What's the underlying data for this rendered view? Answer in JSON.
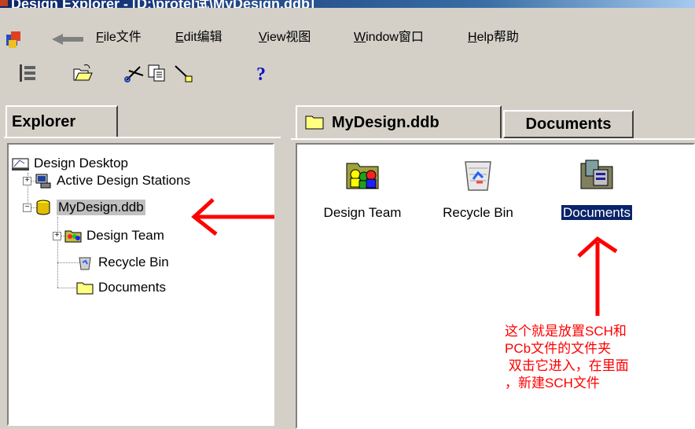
{
  "window": {
    "title": "Design Explorer - [D:\\protel试\\MyDesign.ddb]"
  },
  "menu": {
    "items": [
      {
        "accel": "F",
        "rest": "ile文件"
      },
      {
        "accel": "E",
        "rest": "dit编辑"
      },
      {
        "accel": "V",
        "rest": "iew视图"
      },
      {
        "accel": "W",
        "rest": "indow窗口"
      },
      {
        "accel": "H",
        "rest": "elp帮助"
      }
    ]
  },
  "toolbar": {
    "icons": [
      "tree-toggle-icon",
      "open-folder-icon",
      "cut-icon",
      "copy-icon",
      "paste-icon",
      "help-icon"
    ],
    "help_glyph": "?"
  },
  "explorer": {
    "tab_label": "Explorer",
    "tree": [
      {
        "label": "Design Desktop",
        "icon": "desktop-icon"
      },
      {
        "label": "Active Design Stations",
        "icon": "stations-icon",
        "expander": "+"
      },
      {
        "label": "MyDesign.ddb",
        "icon": "database-icon",
        "expander": "−",
        "highlighted": true
      },
      {
        "label": "Design Team",
        "icon": "team-icon",
        "expander": "+"
      },
      {
        "label": "Recycle Bin",
        "icon": "recycle-bin-icon"
      },
      {
        "label": "Documents",
        "icon": "folder-icon"
      }
    ]
  },
  "content": {
    "tabs": [
      {
        "label": "MyDesign.ddb",
        "icon": "folder-icon",
        "active": true
      },
      {
        "label": "Documents",
        "active": false
      }
    ],
    "items": [
      {
        "label": "Design Team",
        "icon": "team-folder-icon"
      },
      {
        "label": "Recycle Bin",
        "icon": "recycle-bin-icon"
      },
      {
        "label": "Documents",
        "icon": "documents-folder-icon",
        "selected": true
      }
    ]
  },
  "annotation": {
    "lines": [
      "这个就是放置SCH和",
      "PCb文件的文件夹",
      " 双击它进入，在里面",
      "，新建SCH文件"
    ],
    "color": "#ff0000"
  }
}
